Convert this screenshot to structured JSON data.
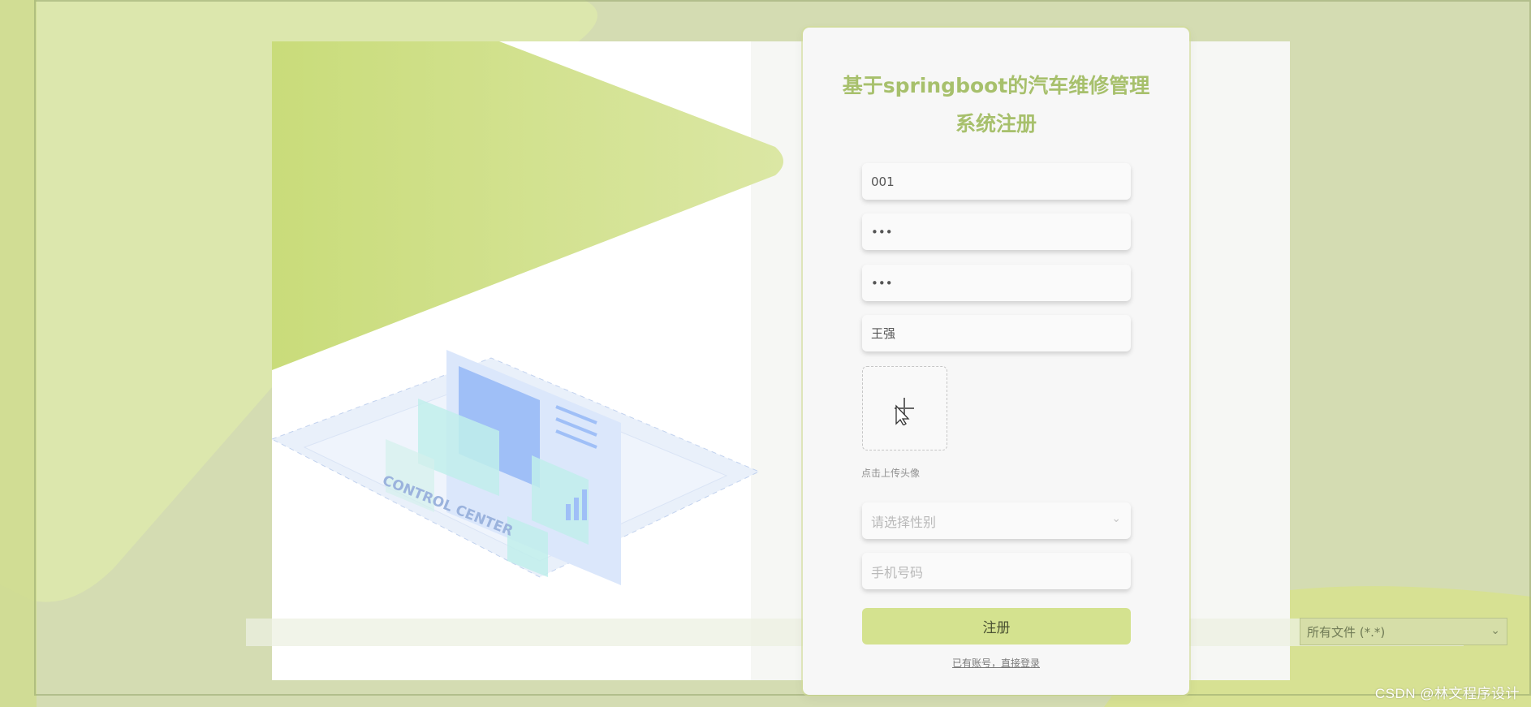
{
  "form": {
    "title_line1": "基于springboot的汽车维修管理",
    "title_line2": "系统注册",
    "account_value": "001",
    "password_value": "•••",
    "confirm_password_value": "•••",
    "name_value": "王强",
    "upload_hint": "点击上传头像",
    "gender_placeholder": "请选择性别",
    "phone_placeholder": "手机号码",
    "submit_label": "注册",
    "login_link": "已有账号，直接登录"
  },
  "illustration": {
    "caption": "CONTROL CENTER"
  },
  "file_dialog": {
    "filter_value": "所有文件 (*.*)"
  },
  "watermark": "CSDN @林文程序设计",
  "colors": {
    "accent": "#a7c06c",
    "button": "#d4e28f",
    "background": "#d4dcb2"
  }
}
